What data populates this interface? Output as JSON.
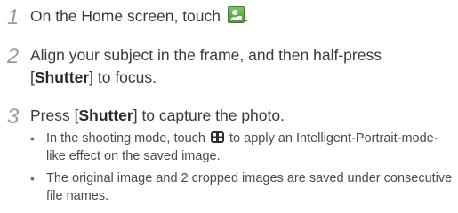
{
  "steps": [
    {
      "num": "1",
      "text_before": "On the Home screen, touch ",
      "icon": "camera-app-icon",
      "text_after": "."
    },
    {
      "num": "2",
      "line1": "Align your subject in the frame, and then half-press",
      "bracket_open": "[",
      "bold": "Shutter",
      "bracket_close": "]",
      "rest": " to focus."
    },
    {
      "num": "3",
      "text_before": "Press [",
      "bold": "Shutter",
      "text_after": "] to capture the photo."
    }
  ],
  "bullets": [
    {
      "before": "In the shooting mode, touch ",
      "icon": "smart-portrait-icon",
      "after": " to apply an Intelligent-Portrait-mode-like effect on the saved image."
    },
    {
      "text": "The original image and 2 cropped images are saved under consecutive file names."
    }
  ],
  "colors": {
    "text": "#3a3a3a",
    "step_number": "#9a9a9a",
    "home_icon": "#5aa84a"
  }
}
